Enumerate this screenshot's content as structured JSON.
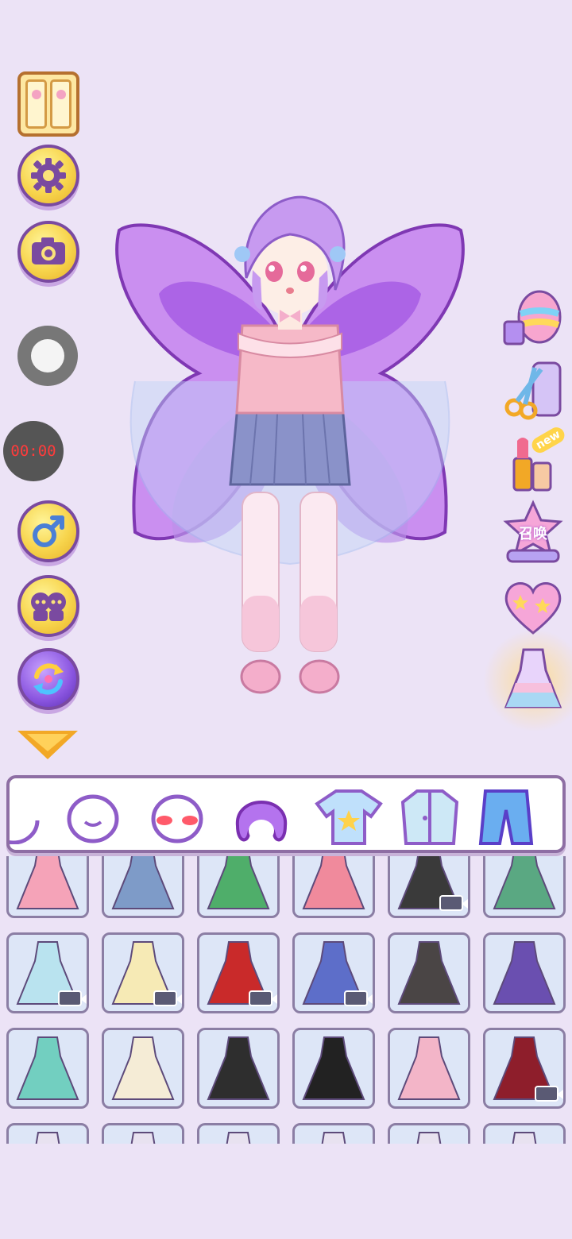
{
  "left_toolbar": {
    "wardrobe_icon": "wardrobe-icon",
    "settings_icon": "gear-icon",
    "camera_icon": "camera-icon",
    "record_icon": "record-icon",
    "timer_text": "00:00",
    "gender_icon": "male-symbol-icon",
    "couple_icon": "couple-icon",
    "random_icon": "shuffle-icon",
    "collapse_icon": "chevron-down-icon"
  },
  "right_toolbar": {
    "items": [
      {
        "name": "makeup-egg-icon"
      },
      {
        "name": "scissors-icon"
      },
      {
        "name": "lipstick-icon",
        "badge": "new"
      },
      {
        "name": "summon-icon",
        "label": "召唤"
      },
      {
        "name": "heart-stars-icon"
      },
      {
        "name": "dress-shop-icon"
      }
    ]
  },
  "categories": [
    {
      "name": "face-shape-icon"
    },
    {
      "name": "face-icon"
    },
    {
      "name": "blush-icon"
    },
    {
      "name": "hair-icon",
      "selected": true
    },
    {
      "name": "tshirt-icon"
    },
    {
      "name": "jacket-icon"
    },
    {
      "name": "pants-icon"
    },
    {
      "name": "more-icon"
    }
  ],
  "grid": {
    "rows": [
      [
        {
          "item": "pink-dress",
          "color": "#f5a3b8",
          "video": false
        },
        {
          "item": "denim-overall-dress",
          "color": "#7e9bc8",
          "video": false
        },
        {
          "item": "green-skirt",
          "color": "#4fae6a",
          "video": false
        },
        {
          "item": "pink-polka-dress",
          "color": "#f08a9c",
          "video": false
        },
        {
          "item": "black-dress",
          "color": "#3a3a3a",
          "video": true
        },
        {
          "item": "green-white-blouse",
          "color": "#5aa882",
          "video": false
        }
      ],
      [
        {
          "item": "pastel-tulle-dress",
          "color": "#b9e3ef",
          "video": true
        },
        {
          "item": "cream-ruffle-dress",
          "color": "#f6eab5",
          "video": true
        },
        {
          "item": "red-qipao",
          "color": "#c92a2a",
          "video": true
        },
        {
          "item": "purple-ballgown",
          "color": "#5d6ec9",
          "video": true
        },
        {
          "item": "black-pinafore",
          "color": "#4a4545",
          "video": false
        },
        {
          "item": "purple-witch-dress",
          "color": "#6a4fb0",
          "video": false
        }
      ],
      [
        {
          "item": "teal-sailor-dress",
          "color": "#72cfc0",
          "video": false
        },
        {
          "item": "beige-lace-dress",
          "color": "#f5ecd6",
          "video": false
        },
        {
          "item": "black-flower-dress",
          "color": "#2e2e2e",
          "video": false
        },
        {
          "item": "white-black-dress",
          "color": "#222222",
          "video": false
        },
        {
          "item": "pink-plaid-outfit",
          "color": "#f3b5c8",
          "video": false
        },
        {
          "item": "red-plaid-dress",
          "color": "#8e1e2b",
          "video": true
        }
      ],
      [
        {
          "item": "partial-1",
          "color": "#e8e2f0",
          "video": false
        },
        {
          "item": "partial-2",
          "color": "#e8e2f0",
          "video": false
        },
        {
          "item": "partial-3",
          "color": "#e8e2f0",
          "video": false
        },
        {
          "item": "partial-4",
          "color": "#e8e2f0",
          "video": false
        },
        {
          "item": "partial-5",
          "color": "#e8e2f0",
          "video": false
        },
        {
          "item": "partial-6",
          "color": "#e8e2f0",
          "video": false
        }
      ]
    ]
  },
  "colors": {
    "background": "#ece3f6",
    "accent_yellow": "#f7d44c",
    "outline_purple": "#7a4aa0",
    "wing_purple": "#b257e0",
    "hair_lilac": "#c79af0"
  }
}
